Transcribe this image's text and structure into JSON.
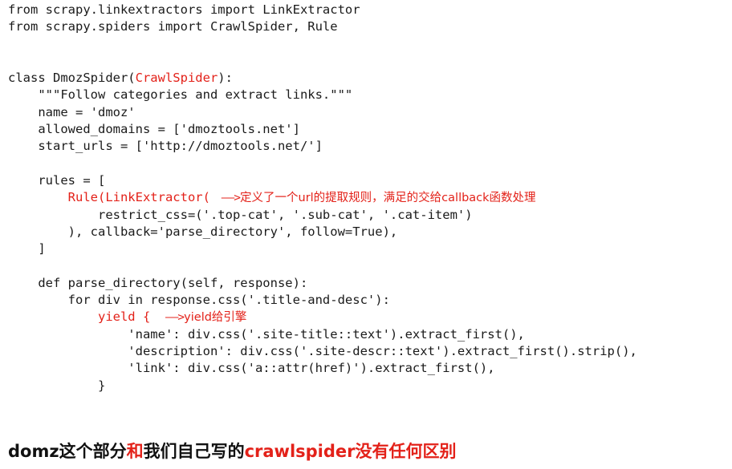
{
  "colors": {
    "text": "#1a1a1a",
    "accent_red": "#e32119",
    "background": "#ffffff"
  },
  "code": {
    "language": "python",
    "lines": [
      {
        "id": "l1",
        "text": "from scrapy.linkextractors import LinkExtractor"
      },
      {
        "id": "l2",
        "text": "from scrapy.spiders import CrawlSpider, Rule"
      },
      {
        "id": "l3",
        "text": ""
      },
      {
        "id": "l4",
        "text": ""
      },
      {
        "id": "l5a",
        "text": "class DmozSpider("
      },
      {
        "id": "l5b",
        "text": "CrawlSpider"
      },
      {
        "id": "l5c",
        "text": "):"
      },
      {
        "id": "l6",
        "text": "    \"\"\"Follow categories and extract links.\"\"\""
      },
      {
        "id": "l7",
        "text": "    name = 'dmoz'"
      },
      {
        "id": "l8",
        "text": "    allowed_domains = ['dmoztools.net']"
      },
      {
        "id": "l9",
        "text": "    start_urls = ['http://dmoztools.net/']"
      },
      {
        "id": "l10",
        "text": ""
      },
      {
        "id": "l11",
        "text": "    rules = ["
      },
      {
        "id": "l12",
        "text": "        Rule(LinkExtractor("
      },
      {
        "id": "l13",
        "text": "            restrict_css=('.top-cat', '.sub-cat', '.cat-item')"
      },
      {
        "id": "l14",
        "text": "        ), callback='parse_directory', follow=True),"
      },
      {
        "id": "l15",
        "text": "    ]"
      },
      {
        "id": "l16",
        "text": ""
      },
      {
        "id": "l17",
        "text": "    def parse_directory(self, response):"
      },
      {
        "id": "l18",
        "text": "        for div in response.css('.title-and-desc'):"
      },
      {
        "id": "l19",
        "text": "            yield {  "
      },
      {
        "id": "l20",
        "text": "                'name': div.css('.site-title::text').extract_first(),"
      },
      {
        "id": "l21",
        "text": "                'description': div.css('.site-descr::text').extract_first().strip(),"
      },
      {
        "id": "l22",
        "text": "                'link': div.css('a::attr(href)').extract_first(),"
      },
      {
        "id": "l23",
        "text": "            }"
      }
    ]
  },
  "annotations": {
    "rule_arrow": "——>",
    "rule_note": "定义了一个url的提取规则，满足的交给callback函数处理",
    "yield_arrow": "——>",
    "yield_note": "yield给引擎"
  },
  "caption": {
    "part1_black": "domz这个部分",
    "part2_red": "和",
    "part3_black": "我们自己写的",
    "part4_red": "crawlspider没有任何区别"
  }
}
